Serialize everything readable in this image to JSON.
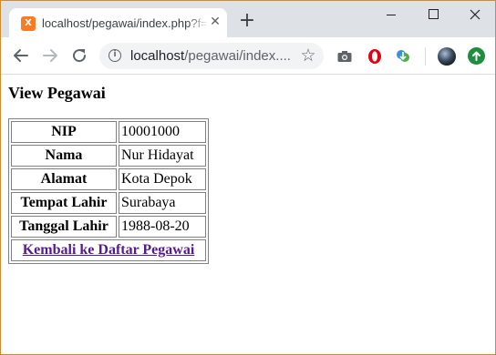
{
  "browser": {
    "tab": {
      "favicon_letter": "X",
      "title": "localhost/pegawai/index.php?f=pegawai"
    },
    "address_bar": {
      "host": "localhost",
      "path": "/pegawai/index...."
    },
    "icons": {
      "back": "arrow-left-icon",
      "forward": "arrow-right-icon",
      "reload": "reload-icon",
      "info": "info-icon",
      "star": "star-icon",
      "camera": "camera-icon",
      "opera": "opera-icon",
      "idm": "download-manager-icon",
      "avatar": "profile-avatar",
      "update": "update-icon"
    },
    "colors": {
      "tabstrip": "#dee1e6",
      "favicon": "#fb7a24",
      "window_border": "#d58a29",
      "visited_link": "#551a8b"
    }
  },
  "page": {
    "heading": "View Pegawai",
    "rows": [
      {
        "label": "NIP",
        "value": "10001000"
      },
      {
        "label": "Nama",
        "value": "Nur Hidayat"
      },
      {
        "label": "Alamat",
        "value": "Kota Depok"
      },
      {
        "label": "Tempat Lahir",
        "value": "Surabaya"
      },
      {
        "label": "Tanggal Lahir",
        "value": "1988-08-20"
      }
    ],
    "back_link": "Kembali ke Daftar Pegawai"
  }
}
